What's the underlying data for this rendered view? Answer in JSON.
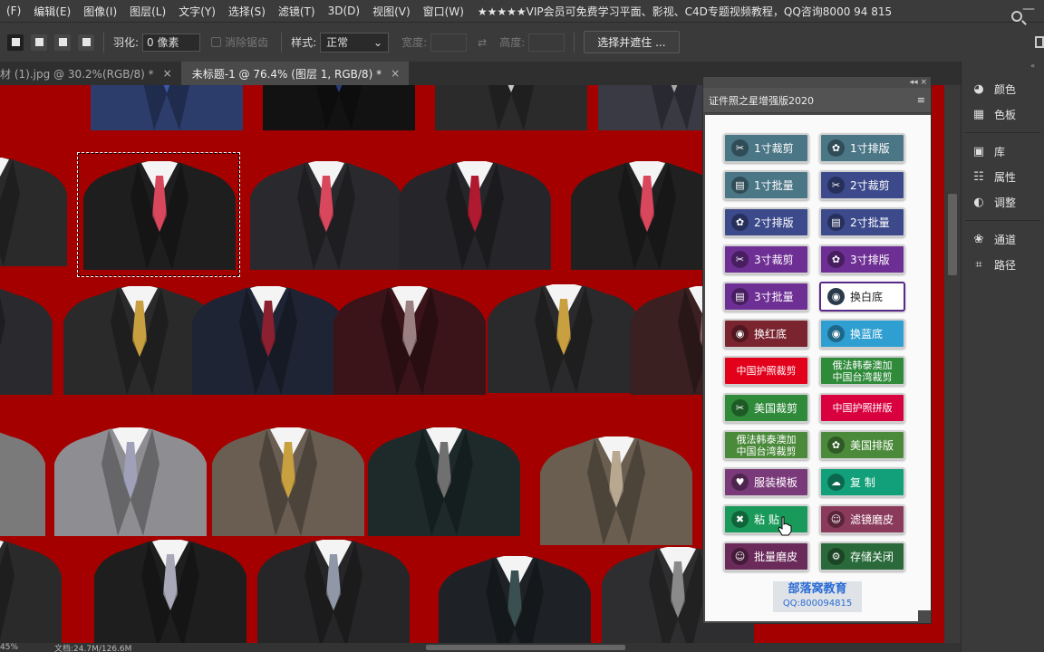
{
  "menubar": {
    "items": [
      "(F)",
      "编辑(E)",
      "图像(I)",
      "图层(L)",
      "文字(Y)",
      "选择(S)",
      "滤镜(T)",
      "3D(D)",
      "视图(V)",
      "窗口(W)"
    ],
    "promo": "★★★★★VIP会员可免费学习平面、影视、C4D专题视频教程，QQ咨询8000 94 815",
    "minimize": "—"
  },
  "options": {
    "feather_label": "羽化:",
    "feather_value": "0 像素",
    "antialias_label": "消除锯齿",
    "style_label": "样式:",
    "style_value": "正常",
    "width_label": "宽度:",
    "height_label": "高度:",
    "select_mask": "选择并遮住 ..."
  },
  "tabs": [
    {
      "label": "材 (1).jpg @ 30.2%(RGB/8) *",
      "close": "×"
    },
    {
      "label": "未标题-1 @ 76.4% (图层 1, RGB/8) *",
      "close": "×"
    }
  ],
  "status": {
    "zoom": "45%",
    "doc": "文档:24.7M/126.6M"
  },
  "right_panel": {
    "collapse": "«",
    "items": [
      {
        "label": "颜色",
        "icon": "palette-icon"
      },
      {
        "label": "色板",
        "icon": "grid-icon"
      },
      {
        "label": "库",
        "icon": "library-icon"
      },
      {
        "label": "属性",
        "icon": "properties-icon"
      },
      {
        "label": "调整",
        "icon": "adjust-icon"
      },
      {
        "label": "通道",
        "icon": "channels-icon"
      },
      {
        "label": "路径",
        "icon": "paths-icon"
      }
    ]
  },
  "plugin": {
    "title": "证件照之星增强版2020",
    "menu": "≡",
    "top_controls": "◂◂  ×",
    "buttons": [
      {
        "label": "1寸裁剪",
        "icon": "scissors-icon",
        "bg": "#4b7686"
      },
      {
        "label": "1寸排版",
        "icon": "film-reel-icon",
        "bg": "#4b7686"
      },
      {
        "label": "1寸批量",
        "icon": "chart-icon",
        "bg": "#4b7686"
      },
      {
        "label": "2寸裁剪",
        "icon": "scissors-icon",
        "bg": "#3c4a8c"
      },
      {
        "label": "2寸排版",
        "icon": "film-reel-icon",
        "bg": "#3c4a8c"
      },
      {
        "label": "2寸批量",
        "icon": "chart-icon",
        "bg": "#3c4a8c"
      },
      {
        "label": "3寸裁剪",
        "icon": "scissors-icon",
        "bg": "#6e2f94"
      },
      {
        "label": "3寸排版",
        "icon": "film-reel-icon",
        "bg": "#6e2f94"
      },
      {
        "label": "3寸批量",
        "icon": "chart-icon",
        "bg": "#6e2f94"
      },
      {
        "label": "换白底",
        "icon": "reel-dark-icon",
        "bg": "#ffffff"
      },
      {
        "label": "换红底",
        "icon": "reel-dark-icon",
        "bg": "#7a2430"
      },
      {
        "label": "换蓝底",
        "icon": "reel-dark-icon",
        "bg": "#2f9fd1"
      },
      {
        "label": "中国护照裁剪",
        "icon": "",
        "bg": "#e3001b"
      },
      {
        "label": "俄法韩泰澳加\n中国台湾裁剪",
        "icon": "",
        "bg": "#2f8a3a"
      },
      {
        "label": "美国裁剪",
        "icon": "scissors-icon",
        "bg": "#2f8a3a"
      },
      {
        "label": "中国护照拼版",
        "icon": "",
        "bg": "#d9003f"
      },
      {
        "label": "俄法韩泰澳加\n中国台湾裁剪",
        "icon": "",
        "bg": "#4a8a3a"
      },
      {
        "label": "美国排版",
        "icon": "film-reel-icon",
        "bg": "#4a8a3a"
      },
      {
        "label": "服装模板",
        "icon": "suit-icon",
        "bg": "#7a3a7a"
      },
      {
        "label": "复  制",
        "icon": "cloud-icon",
        "bg": "#12a07a"
      },
      {
        "label": "粘  贴",
        "icon": "x-icon",
        "bg": "#1a9a5a"
      },
      {
        "label": "滤镜磨皮",
        "icon": "person-icon",
        "bg": "#8a3a5a"
      },
      {
        "label": "批量磨皮",
        "icon": "person-icon",
        "bg": "#6a2a5a"
      },
      {
        "label": "存储关闭",
        "icon": "wrench-icon",
        "bg": "#2a6a3a"
      }
    ],
    "brand_name": "部落窝教育",
    "brand_qq": "QQ:800094815"
  }
}
